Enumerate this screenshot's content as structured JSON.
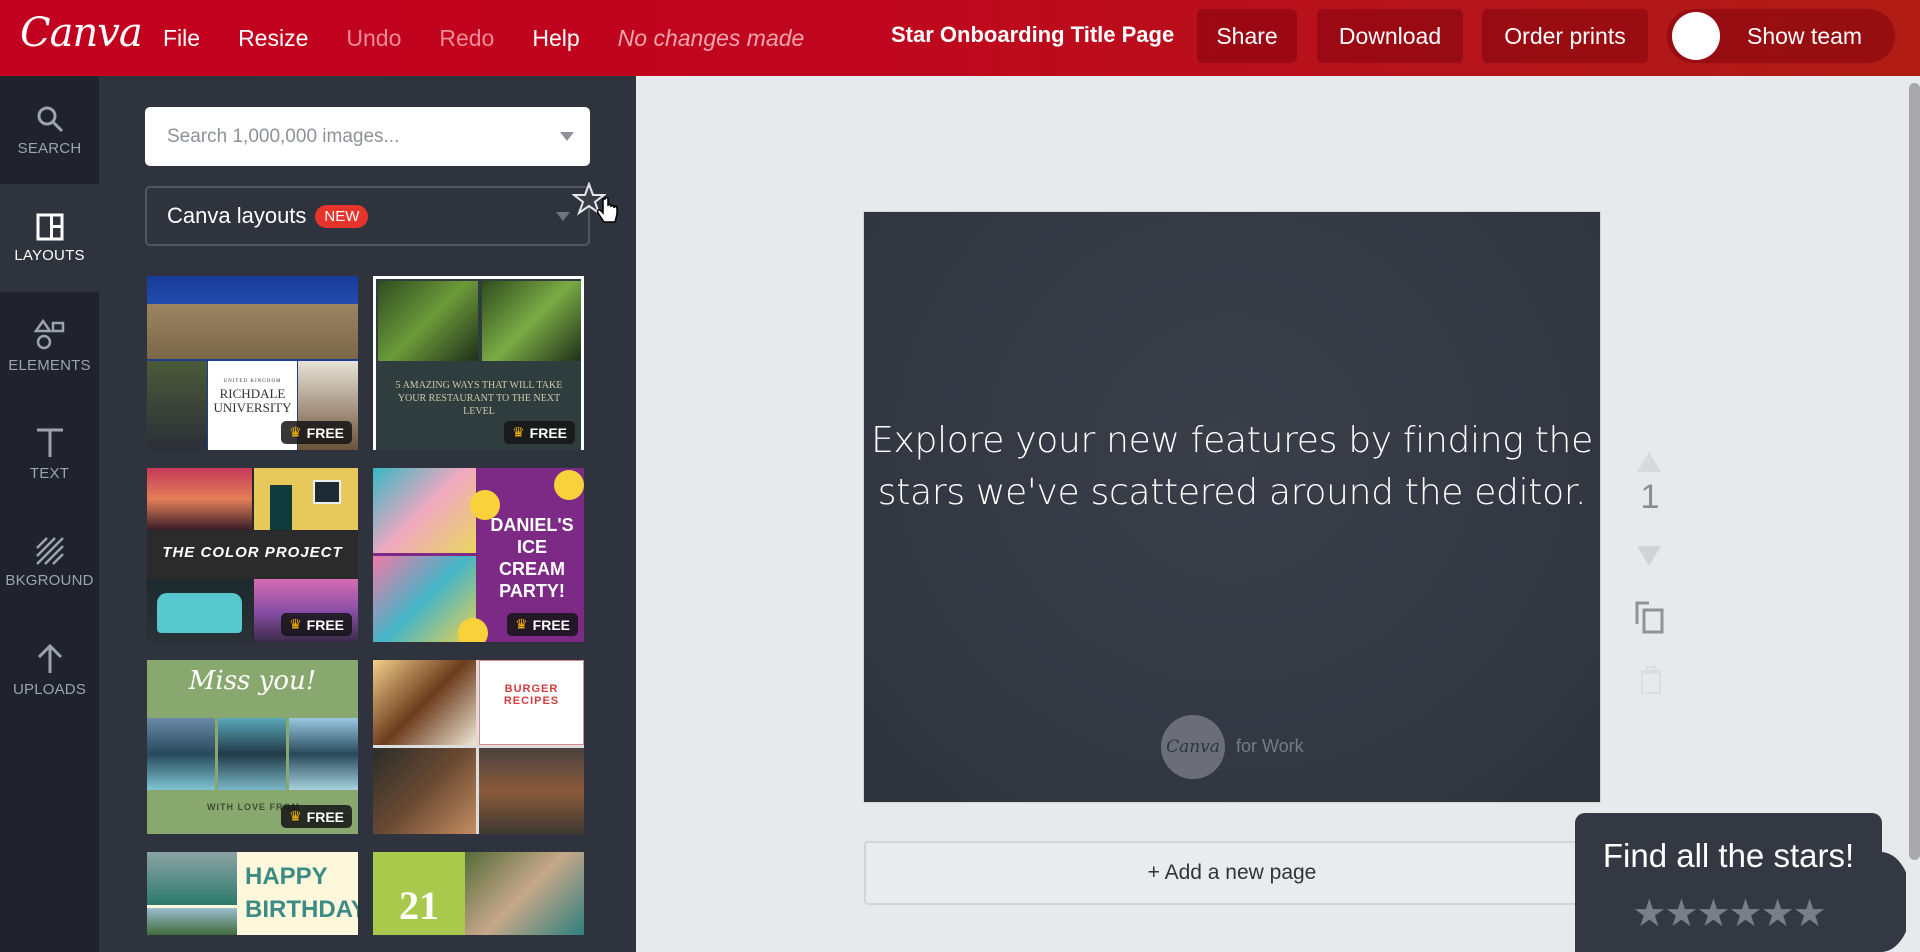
{
  "header": {
    "logo": "Canva",
    "menu": [
      {
        "label": "File",
        "enabled": true
      },
      {
        "label": "Resize",
        "enabled": true
      },
      {
        "label": "Undo",
        "enabled": false
      },
      {
        "label": "Redo",
        "enabled": false
      },
      {
        "label": "Help",
        "enabled": true
      }
    ],
    "status": "No changes made",
    "document_title": "Star Onboarding Title Page",
    "buttons": {
      "share": "Share",
      "download": "Download",
      "order_prints": "Order prints",
      "show_team": "Show team"
    },
    "brand_color": "#c2001f"
  },
  "rail": {
    "items": [
      {
        "label": "SEARCH",
        "icon": "search-icon",
        "active": false
      },
      {
        "label": "LAYOUTS",
        "icon": "layouts-icon",
        "active": true
      },
      {
        "label": "ELEMENTS",
        "icon": "shapes-icon",
        "active": false
      },
      {
        "label": "TEXT",
        "icon": "text-icon",
        "active": false
      },
      {
        "label": "BKGROUND",
        "icon": "background-icon",
        "active": false
      },
      {
        "label": "UPLOADS",
        "icon": "upload-arrow-icon",
        "active": false
      }
    ]
  },
  "panel": {
    "search_placeholder": "Search 1,000,000 images...",
    "layouts_select": {
      "label": "Canva layouts",
      "badge": "NEW"
    },
    "free_label": "FREE",
    "thumbnails": [
      {
        "title_lines": [
          "UNITED KINGDOM",
          "RICHDALE UNIVERSITY"
        ],
        "free": true
      },
      {
        "title_lines": [
          "5 AMAZING WAYS THAT WILL TAKE YOUR RESTAURANT TO THE NEXT LEVEL"
        ],
        "free": true
      },
      {
        "title_lines": [
          "THE COLOR PROJECT"
        ],
        "free": true
      },
      {
        "title_lines": [
          "DANIEL'S ICE CREAM PARTY!"
        ],
        "free": true
      },
      {
        "title_lines": [
          "Miss you!",
          "WITH LOVE FROM"
        ],
        "free": true
      },
      {
        "title_lines": [
          "BURGER RECIPES"
        ],
        "free": false
      },
      {
        "title_lines": [
          "HAPPY BIRTHDAY"
        ],
        "free": false
      },
      {
        "title_lines": [
          "21"
        ],
        "free": false
      }
    ]
  },
  "canvas": {
    "text": "Explore your new features by finding the stars we've scattered around the editor.",
    "logo_text": "Canva",
    "logo_suffix": "for Work",
    "page_number": "1",
    "add_page": "+ Add a new page"
  },
  "stars_popup": {
    "title": "Find all the stars!",
    "stars": "★★★★★★",
    "found": 0,
    "total": 6
  }
}
